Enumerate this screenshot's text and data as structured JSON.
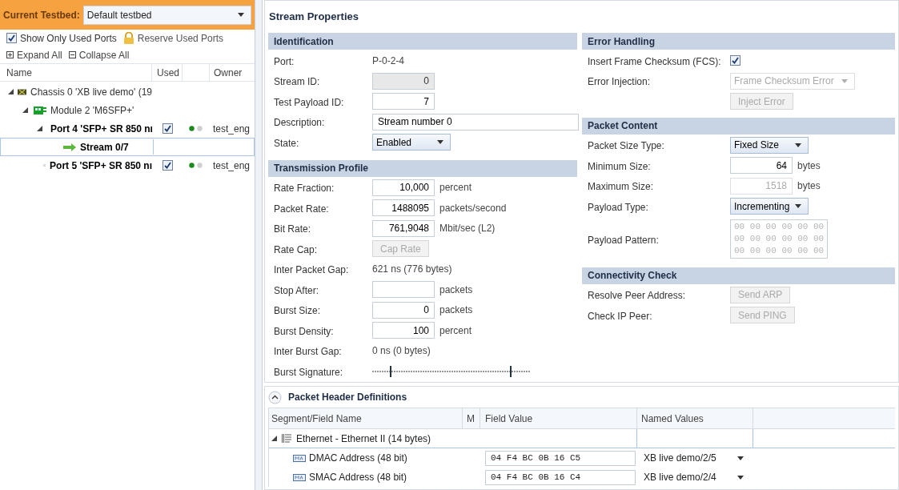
{
  "testbed": {
    "label": "Current Testbed:",
    "value": "Default testbed"
  },
  "options": [
    {
      "kind": "checkbox",
      "label": "Show Only Used Ports",
      "checked": true
    },
    {
      "kind": "lock",
      "label": "Reserve Used Ports"
    }
  ],
  "tree_actions": [
    {
      "kind": "expand",
      "label": "Expand All"
    },
    {
      "kind": "collapse",
      "label": "Collapse All"
    }
  ],
  "tree_columns": [
    "Name",
    "Used",
    "Owner"
  ],
  "tree": [
    {
      "kind": "chassis",
      "label": "Chassis 0 'XB live demo' (19",
      "expanded": true,
      "children": [
        {
          "kind": "module",
          "label": "Module 2 'M6SFP+'",
          "expanded": true,
          "children": [
            {
              "kind": "port",
              "label": "Port 4 'SFP+ SR 850 nı",
              "expanded": true,
              "used": true,
              "owner": "test_eng",
              "children": [
                {
                  "kind": "stream",
                  "label": "Stream 0/7",
                  "selected": true
                }
              ]
            },
            {
              "kind": "port",
              "label": "Port 5 'SFP+ SR 850 nı",
              "used": true,
              "owner": "test_eng"
            }
          ]
        }
      ]
    }
  ],
  "properties_title": "Stream Properties",
  "left_sections": [
    {
      "title": "Identification",
      "rows": [
        {
          "kind": "text",
          "label": "Port:",
          "value": "P-0-2-4"
        },
        {
          "kind": "input",
          "label": "Stream ID:",
          "value": "0",
          "readonly": true
        },
        {
          "kind": "input",
          "label": "Test Payload ID:",
          "value": "7",
          "disabled": false
        },
        {
          "kind": "wide",
          "label": "Description:",
          "value": "Stream number 0"
        },
        {
          "kind": "select",
          "label": "State:",
          "value": "Enabled",
          "disabled": false
        }
      ]
    },
    {
      "title": "Transmission Profile",
      "rows": [
        {
          "kind": "input",
          "label": "Rate Fraction:",
          "value": "10,000",
          "unit": "percent",
          "disabled": false
        },
        {
          "kind": "input",
          "label": "Packet Rate:",
          "value": "1488095",
          "unit": "packets/second",
          "disabled": false
        },
        {
          "kind": "input",
          "label": "Bit Rate:",
          "value": "761,9048",
          "unit": "Mbit/sec (L2)",
          "disabled": false
        },
        {
          "kind": "button",
          "label": "Rate Cap:",
          "value": "Cap Rate",
          "disabled": true
        },
        {
          "kind": "text",
          "label": "Inter Packet Gap:",
          "value": "621 ns (776 bytes)"
        },
        {
          "kind": "input",
          "label": "Stop After:",
          "unit": "packets",
          "disabled": false
        },
        {
          "kind": "input",
          "label": "Burst Size:",
          "value": "0",
          "unit": "packets",
          "disabled": false
        },
        {
          "kind": "input",
          "label": "Burst Density:",
          "value": "100",
          "unit": "percent",
          "disabled": false
        },
        {
          "kind": "text",
          "label": "Inter Burst Gap:",
          "value": "0 ns (0 bytes)"
        },
        {
          "kind": "signature",
          "label": "Burst Signature:"
        }
      ]
    }
  ],
  "right_sections": [
    {
      "title": "Error Handling",
      "rows": [
        {
          "kind": "checkbox",
          "label": "Insert Frame Checksum (FCS):",
          "checked": true
        },
        {
          "kind": "wideselect",
          "label": "Error Injection:",
          "value": "Frame Checksum Error",
          "disabled": true
        },
        {
          "kind": "button",
          "value": "Inject Error",
          "disabled": true
        }
      ]
    },
    {
      "title": "Packet Content",
      "rows": [
        {
          "kind": "select",
          "label": "Packet Size Type:",
          "value": "Fixed Size",
          "disabled": false
        },
        {
          "kind": "input",
          "label": "Minimum Size:",
          "value": "64",
          "unit": "bytes",
          "disabled": false
        },
        {
          "kind": "input",
          "label": "Maximum Size:",
          "value": "1518",
          "unit": "bytes",
          "disabled": true
        },
        {
          "kind": "select",
          "label": "Payload Type:",
          "value": "Incrementing",
          "disabled": false
        },
        {
          "kind": "pattern",
          "label": "Payload Pattern:",
          "lines": [
            "00 00 00 00 00 00",
            "00 00 00 00 00 00",
            "00 00 00 00 00 00"
          ]
        }
      ]
    },
    {
      "title": "Connectivity Check",
      "rows": [
        {
          "kind": "button",
          "label": "Resolve Peer Address:",
          "value": "Send ARP",
          "disabled": true
        },
        {
          "kind": "button",
          "label": "Check IP Peer:",
          "value": "Send PING",
          "disabled": true
        }
      ]
    }
  ],
  "header_defs": {
    "title": "Packet Header Definitions",
    "expanded": true,
    "columns": [
      "Segment/Field Name",
      "M",
      "Field Value",
      "Named Values"
    ],
    "segment": {
      "label": "Ethernet - Ethernet II (14 bytes)",
      "expanded": true
    },
    "fields": [
      {
        "name": "DMAC Address (48 bit)",
        "value": "04 F4 BC 0B 16 C5",
        "named": "XB live demo/2/5"
      },
      {
        "name": "SMAC Address (48 bit)",
        "value": "04 F4 BC 0B 16 C4",
        "named": "XB live demo/2/4"
      }
    ]
  }
}
